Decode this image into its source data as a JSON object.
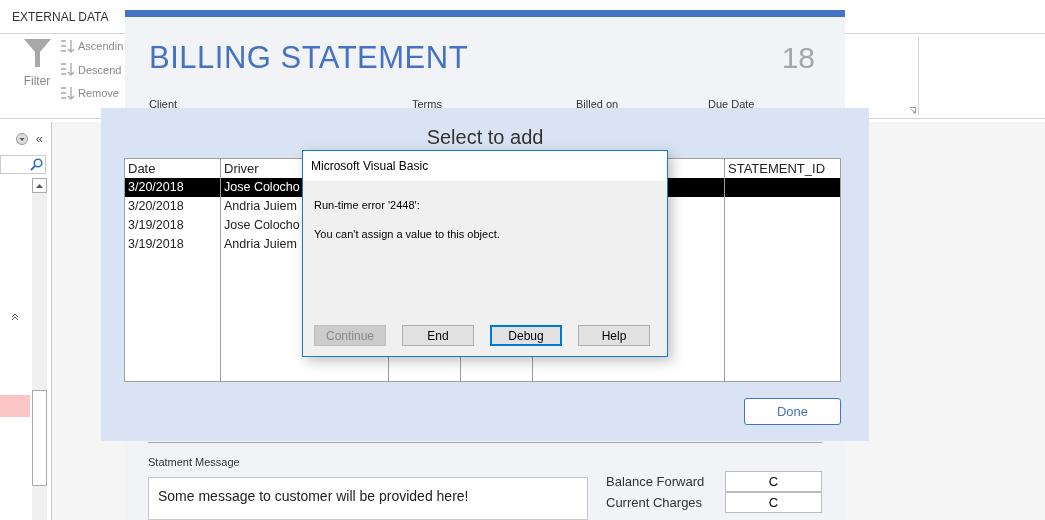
{
  "nav_pane": {
    "collapse": "«"
  },
  "ribbon": {
    "tab": "EXTERNAL DATA",
    "filter_label": "Filter",
    "sort_items": [
      "Ascendin",
      "Descend",
      "Remove"
    ]
  },
  "billing_form": {
    "title": "BILLING STATEMENT",
    "number": "18",
    "fields": [
      "Client",
      "Terms",
      "Billed on",
      "Due Date"
    ],
    "message_label": "Statment Message",
    "message": "Some message to customer will be provided here!",
    "totals": [
      {
        "label": "Balance Forward",
        "value": "C"
      },
      {
        "label": "Current Charges",
        "value": "C"
      }
    ]
  },
  "picker": {
    "title": "Select to add",
    "columns": [
      "Date",
      "Driver",
      "STATEMENT_ID"
    ],
    "rows": [
      {
        "date": "3/20/2018",
        "driver": "Jose Colocho",
        "selected": true
      },
      {
        "date": "3/20/2018",
        "driver": "Andria Juiem",
        "selected": false
      },
      {
        "date": "3/19/2018",
        "driver": "Jose Colocho",
        "selected": false
      },
      {
        "date": "3/19/2018",
        "driver": "Andria Juiem",
        "selected": false
      }
    ],
    "done_button": "Done"
  },
  "dialog": {
    "title": "Microsoft Visual Basic",
    "error": "Run-time error '2448':",
    "message": "You can't assign a value to this object.",
    "buttons": [
      {
        "label": "Continue",
        "disabled": true,
        "focused": false
      },
      {
        "label": "End",
        "disabled": false,
        "focused": false
      },
      {
        "label": "Debug",
        "disabled": false,
        "focused": true
      },
      {
        "label": "Help",
        "disabled": false,
        "focused": false
      }
    ]
  }
}
